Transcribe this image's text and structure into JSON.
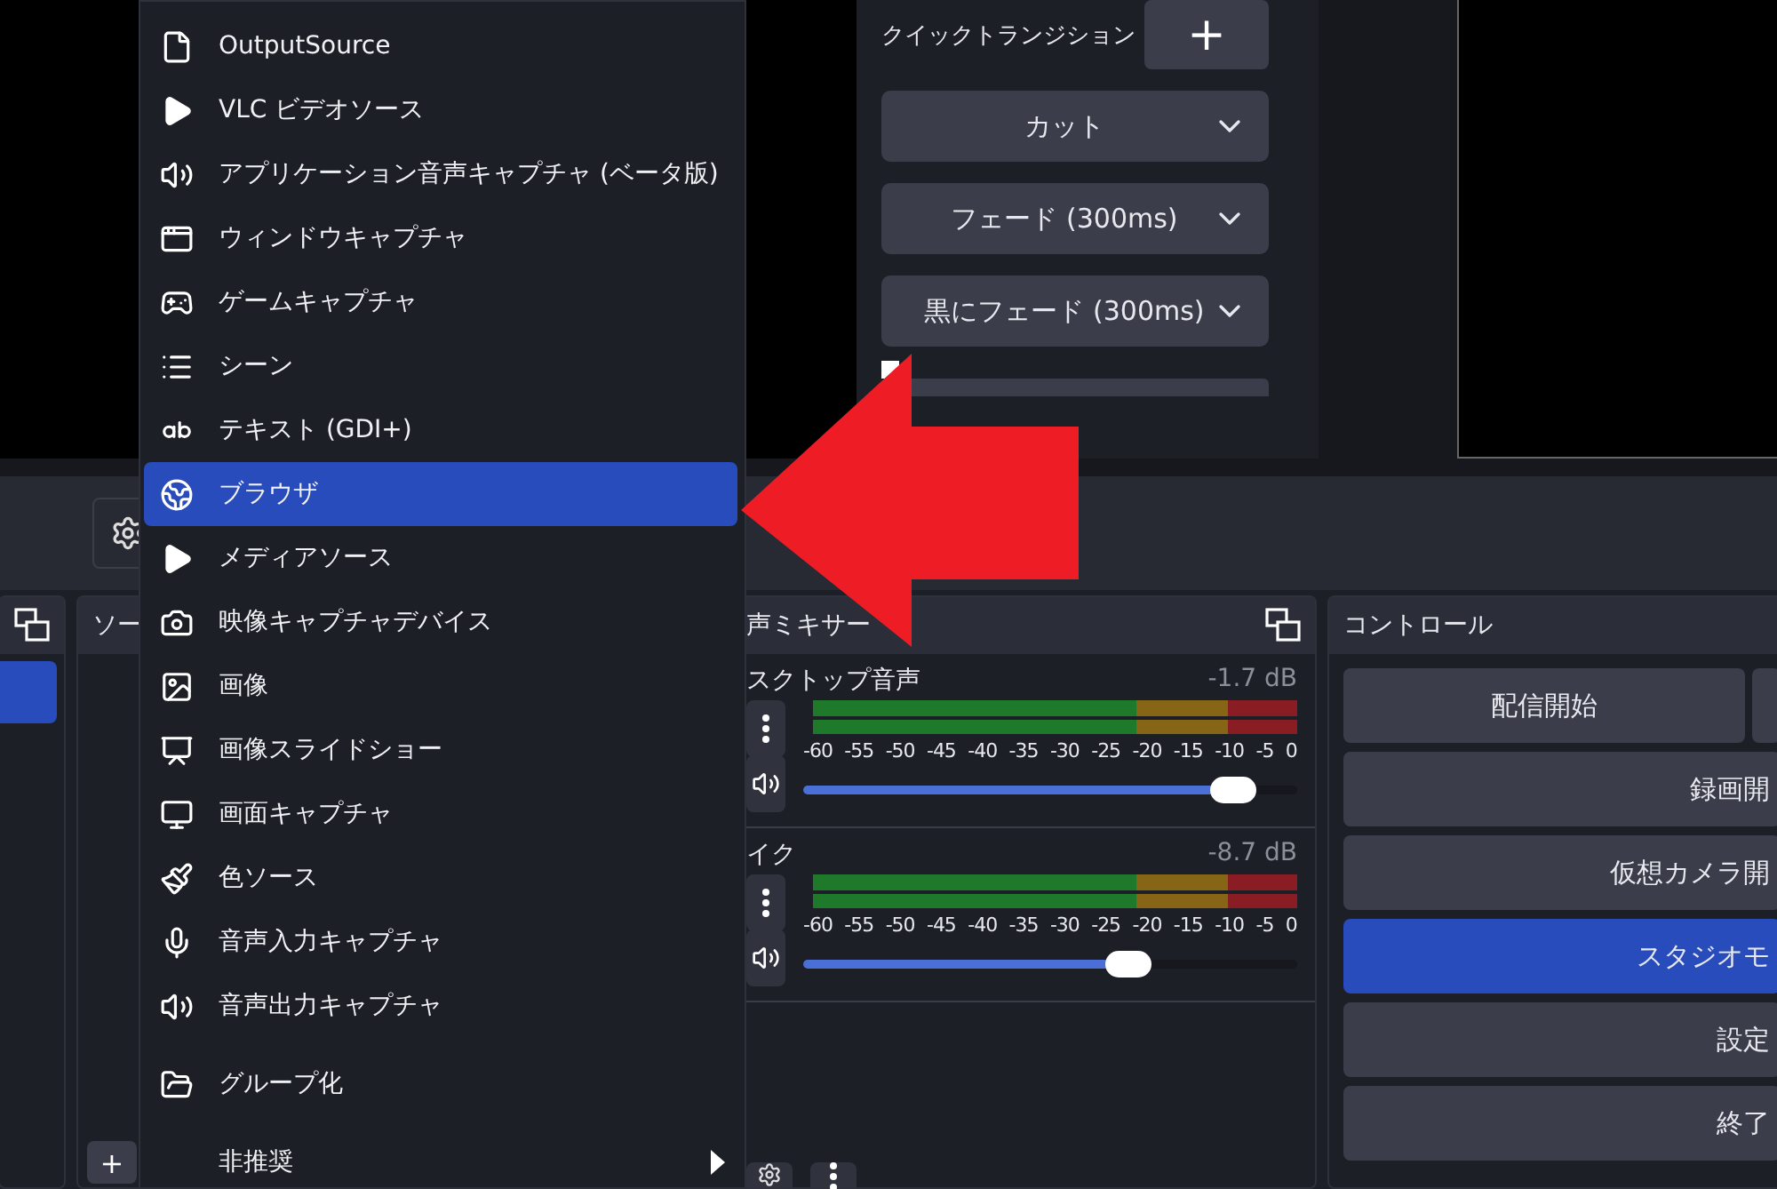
{
  "transitions": {
    "label": "クイックトランジション",
    "add_button": "+",
    "dropdowns": [
      {
        "value": "カット"
      },
      {
        "value": "フェード (300ms)"
      },
      {
        "value": "黒にフェード (300ms)"
      }
    ],
    "checkbox": {
      "checked": true
    }
  },
  "scenes_dock": {
    "items": [
      {
        "selected": true
      }
    ]
  },
  "sources_dock": {
    "title": "ソー",
    "add_button": "+"
  },
  "mixer": {
    "title": "声ミキサー",
    "channels": [
      {
        "name": "スクトップ音声",
        "reading": "-1.7 dB",
        "level": 0.87,
        "scale": [
          "-60",
          "-55",
          "-50",
          "-45",
          "-40",
          "-35",
          "-30",
          "-25",
          "-20",
          "-15",
          "-10",
          "-5",
          "0"
        ]
      },
      {
        "name": "イク",
        "reading": "-8.7 dB",
        "level": 0.66,
        "scale": [
          "-60",
          "-55",
          "-50",
          "-45",
          "-40",
          "-35",
          "-30",
          "-25",
          "-20",
          "-15",
          "-10",
          "-5",
          "0"
        ]
      }
    ]
  },
  "controls": {
    "title": "コントロール",
    "rows": [
      [
        {
          "label": "配信開始",
          "selected": false
        },
        {
          "selected": false
        }
      ],
      [
        {
          "label": "録画開",
          "selected": false
        }
      ],
      [
        {
          "label": "仮想カメラ開",
          "selected": false
        }
      ],
      [
        {
          "label": "スタジオモ",
          "selected": true
        }
      ],
      [
        {
          "label": "設定",
          "selected": false
        }
      ],
      [
        {
          "label": "終了",
          "selected": false
        }
      ]
    ]
  },
  "menu": {
    "sections": [
      [
        {
          "label": "OutputSource",
          "selected": false
        },
        {
          "label": "VLC ビデオソース",
          "selected": false
        },
        {
          "label": "アプリケーション音声キャプチャ (ベータ版)",
          "selected": false
        },
        {
          "label": "ウィンドウキャプチャ",
          "selected": false
        },
        {
          "label": "ゲームキャプチャ",
          "selected": false
        },
        {
          "label": "シーン",
          "selected": false
        },
        {
          "label": "テキスト (GDI+)",
          "selected": false
        },
        {
          "label": "ブラウザ",
          "selected": true
        },
        {
          "label": "メディアソース",
          "selected": false
        },
        {
          "label": "映像キャプチャデバイス",
          "selected": false
        },
        {
          "label": "画像",
          "selected": false
        },
        {
          "label": "画像スライドショー",
          "selected": false
        },
        {
          "label": "画面キャプチャ",
          "selected": false
        },
        {
          "label": "色ソース",
          "selected": false
        },
        {
          "label": "音声入力キャプチャ",
          "selected": false
        },
        {
          "label": "音声出力キャプチャ",
          "selected": false
        }
      ],
      [
        {
          "label": "グループ化",
          "selected": false
        }
      ],
      [
        {
          "label": "非推奨",
          "selected": false,
          "submenu": true
        }
      ]
    ]
  }
}
